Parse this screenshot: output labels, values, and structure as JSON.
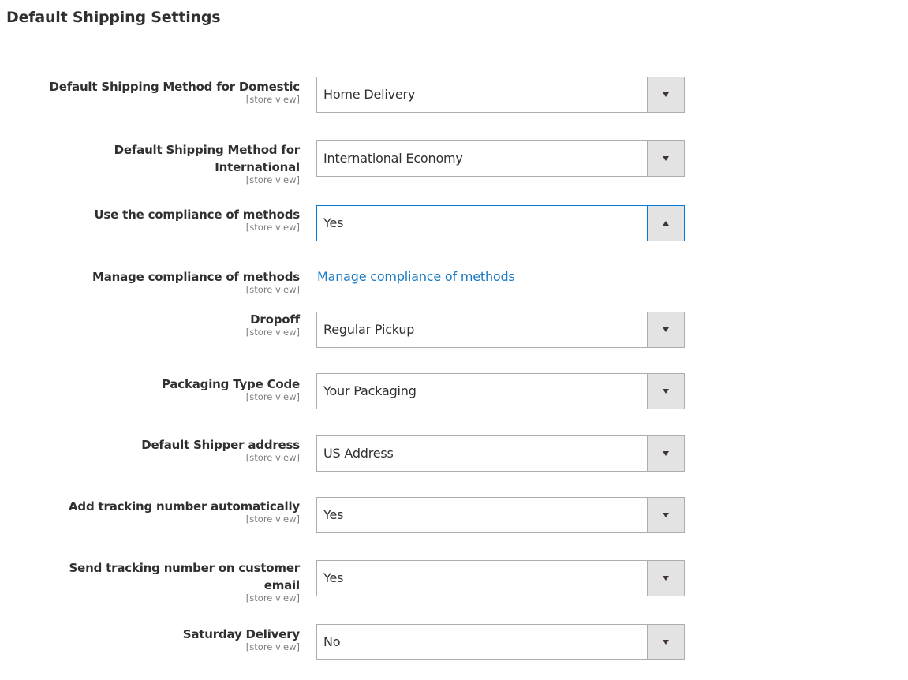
{
  "section": {
    "title": "Default Shipping Settings"
  },
  "fields": [
    {
      "label": "Default Shipping Method for Domestic",
      "scope": "[store view]",
      "value": "Home Delivery"
    },
    {
      "label_line1": "Default Shipping Method for",
      "label_line2": "International",
      "scope": "[store view]",
      "value": "International Economy"
    },
    {
      "label": "Use the compliance of methods",
      "scope": "[store view]",
      "value": "Yes"
    },
    {
      "label": "Manage compliance of methods",
      "scope": "[store view]",
      "link_text": "Manage compliance of methods"
    },
    {
      "label": "Dropoff",
      "scope": "[store view]",
      "value": "Regular Pickup"
    },
    {
      "label": "Packaging Type Code",
      "scope": "[store view]",
      "value": "Your Packaging"
    },
    {
      "label": "Default Shipper address",
      "scope": "[store view]",
      "value": "US Address"
    },
    {
      "label": "Add tracking number automatically",
      "scope": "[store view]",
      "value": "Yes"
    },
    {
      "label_line1": "Send tracking number on customer",
      "label_line2": "email",
      "scope": "[store view]",
      "value": "Yes"
    },
    {
      "label": "Saturday Delivery",
      "scope": "[store view]",
      "value": "No"
    }
  ],
  "colors": {
    "link": "#1979c3",
    "focus_border": "#007bdb",
    "select_border": "#adadad",
    "select_button": "#e3e3e3"
  }
}
